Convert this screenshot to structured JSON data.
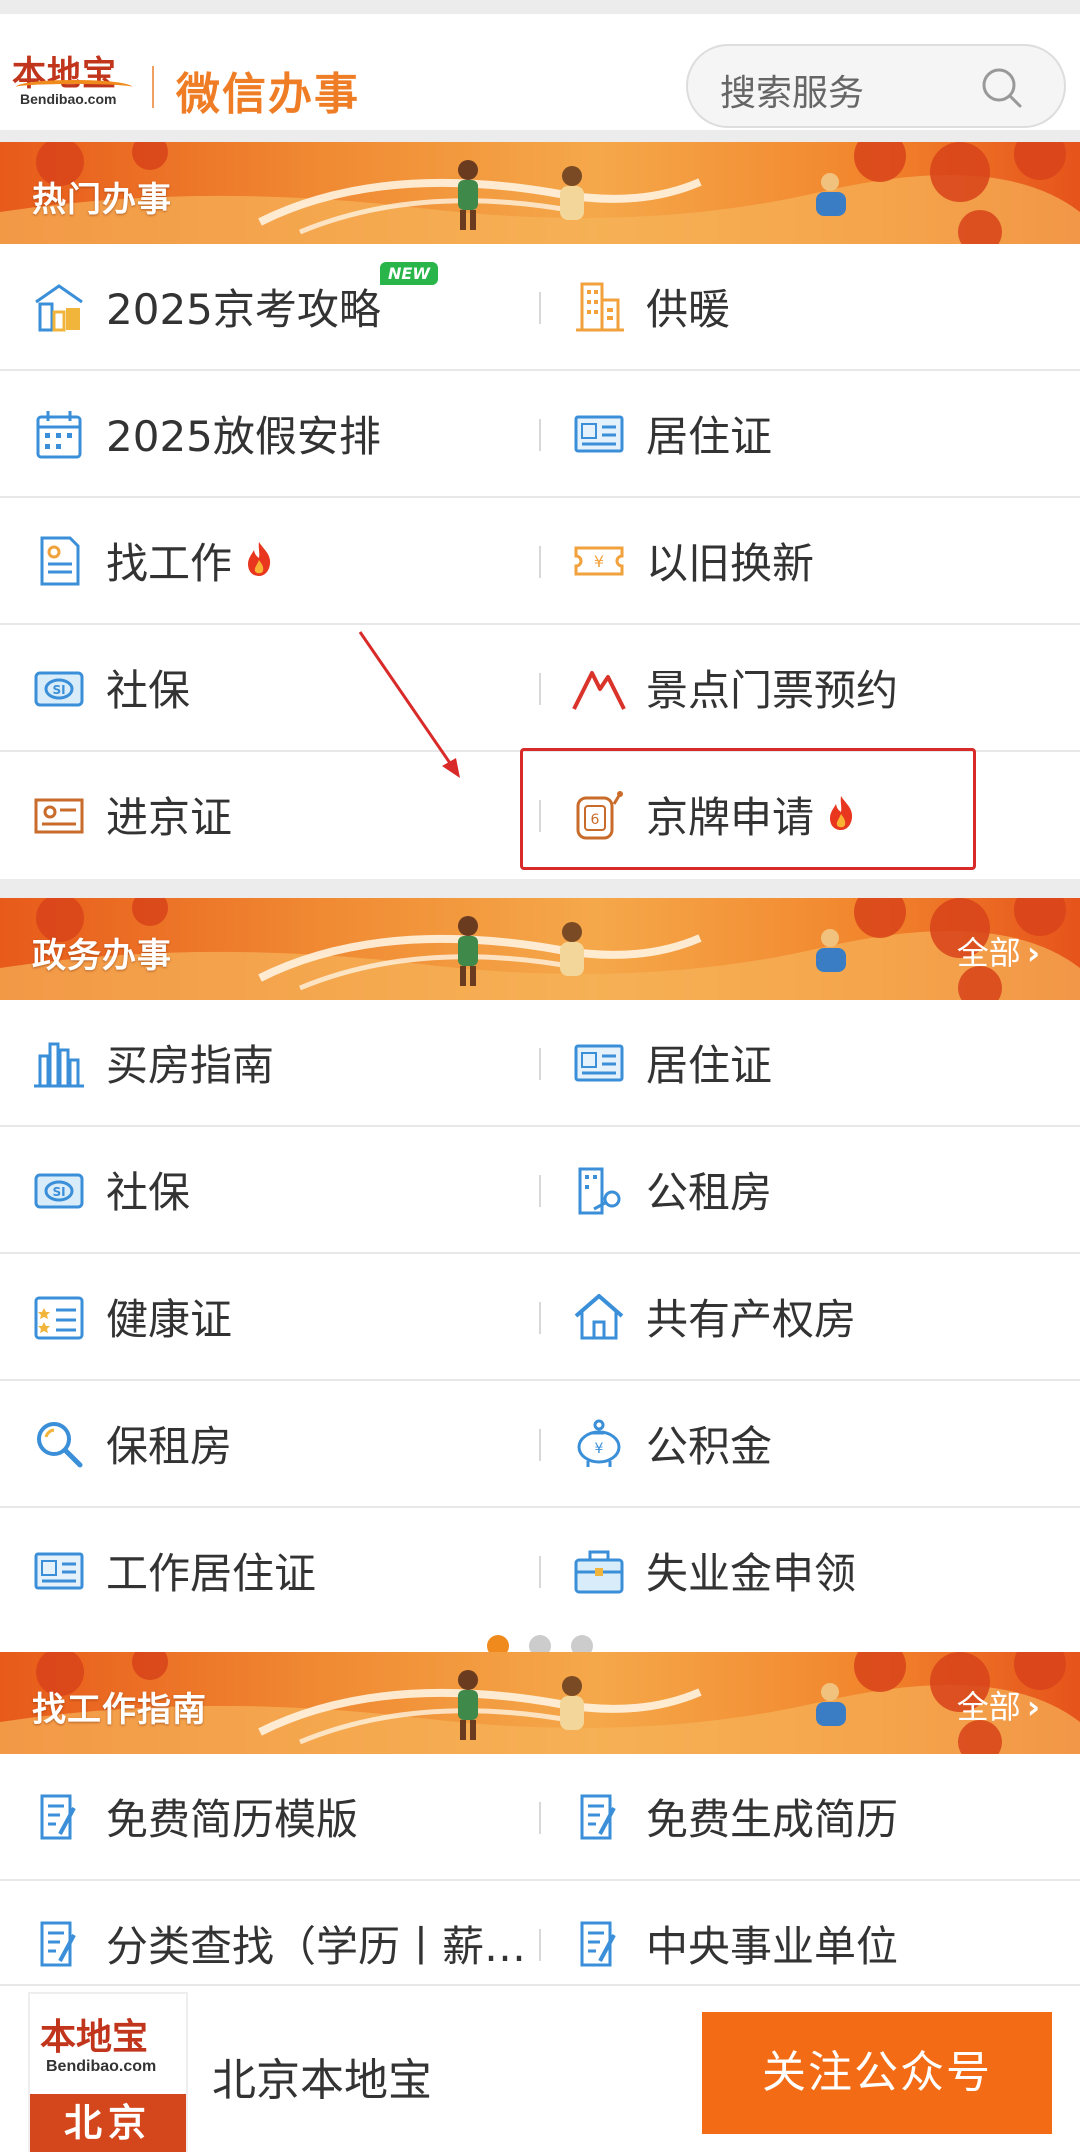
{
  "header": {
    "logo_text": "本地宝",
    "logo_domain": "Bendibao.com",
    "title": "微信办事",
    "search_placeholder": "搜索服务"
  },
  "sections": [
    {
      "title": "热门办事",
      "more": "",
      "rows": [
        [
          {
            "label": "2025京考攻略",
            "icon": "school-icon",
            "badge": "NEW"
          },
          {
            "label": "供暖",
            "icon": "building-icon"
          }
        ],
        [
          {
            "label": "2025放假安排",
            "icon": "calendar-icon"
          },
          {
            "label": "居住证",
            "icon": "id-card-icon"
          }
        ],
        [
          {
            "label": "找工作",
            "icon": "resume-icon",
            "hot": true
          },
          {
            "label": "以旧换新",
            "icon": "coupon-icon"
          }
        ],
        [
          {
            "label": "社保",
            "icon": "social-security-icon"
          },
          {
            "label": "景点门票预约",
            "icon": "mountain-icon"
          }
        ],
        [
          {
            "label": "进京证",
            "icon": "pass-card-icon"
          },
          {
            "label": "京牌申请",
            "icon": "license-lottery-icon",
            "hot": true
          }
        ]
      ]
    },
    {
      "title": "政务办事",
      "more": "全部",
      "rows": [
        [
          {
            "label": "买房指南",
            "icon": "city-icon"
          },
          {
            "label": "居住证",
            "icon": "id-card-icon"
          }
        ],
        [
          {
            "label": "社保",
            "icon": "social-security-icon"
          },
          {
            "label": "公租房",
            "icon": "house-key-icon"
          }
        ],
        [
          {
            "label": "健康证",
            "icon": "health-card-icon"
          },
          {
            "label": "共有产权房",
            "icon": "home-icon"
          }
        ],
        [
          {
            "label": "保租房",
            "icon": "search-icon"
          },
          {
            "label": "公积金",
            "icon": "piggy-bank-icon"
          }
        ],
        [
          {
            "label": "工作居住证",
            "icon": "id-card-icon"
          },
          {
            "label": "失业金申领",
            "icon": "briefcase-icon"
          }
        ]
      ]
    },
    {
      "title": "找工作指南",
      "more": "全部",
      "rows": [
        [
          {
            "label": "免费简历模版",
            "icon": "edit-doc-icon"
          },
          {
            "label": "免费生成简历",
            "icon": "edit-doc-icon"
          }
        ],
        [
          {
            "label": "分类查找（学历丨薪…",
            "icon": "edit-doc-icon"
          },
          {
            "label": "中央事业单位",
            "icon": "edit-doc-icon"
          }
        ]
      ]
    }
  ],
  "pager": {
    "count": 3,
    "active": 0
  },
  "footer": {
    "logo_text": "本地宝",
    "logo_domain": "Bendibao.com",
    "city": "北京",
    "account_name": "北京本地宝",
    "follow_button": "关注公众号"
  },
  "colors": {
    "brand_orange": "#f36b14",
    "title_orange": "#ef7d25",
    "highlight_red": "#d92a2a",
    "new_badge_green": "#29b54a"
  }
}
